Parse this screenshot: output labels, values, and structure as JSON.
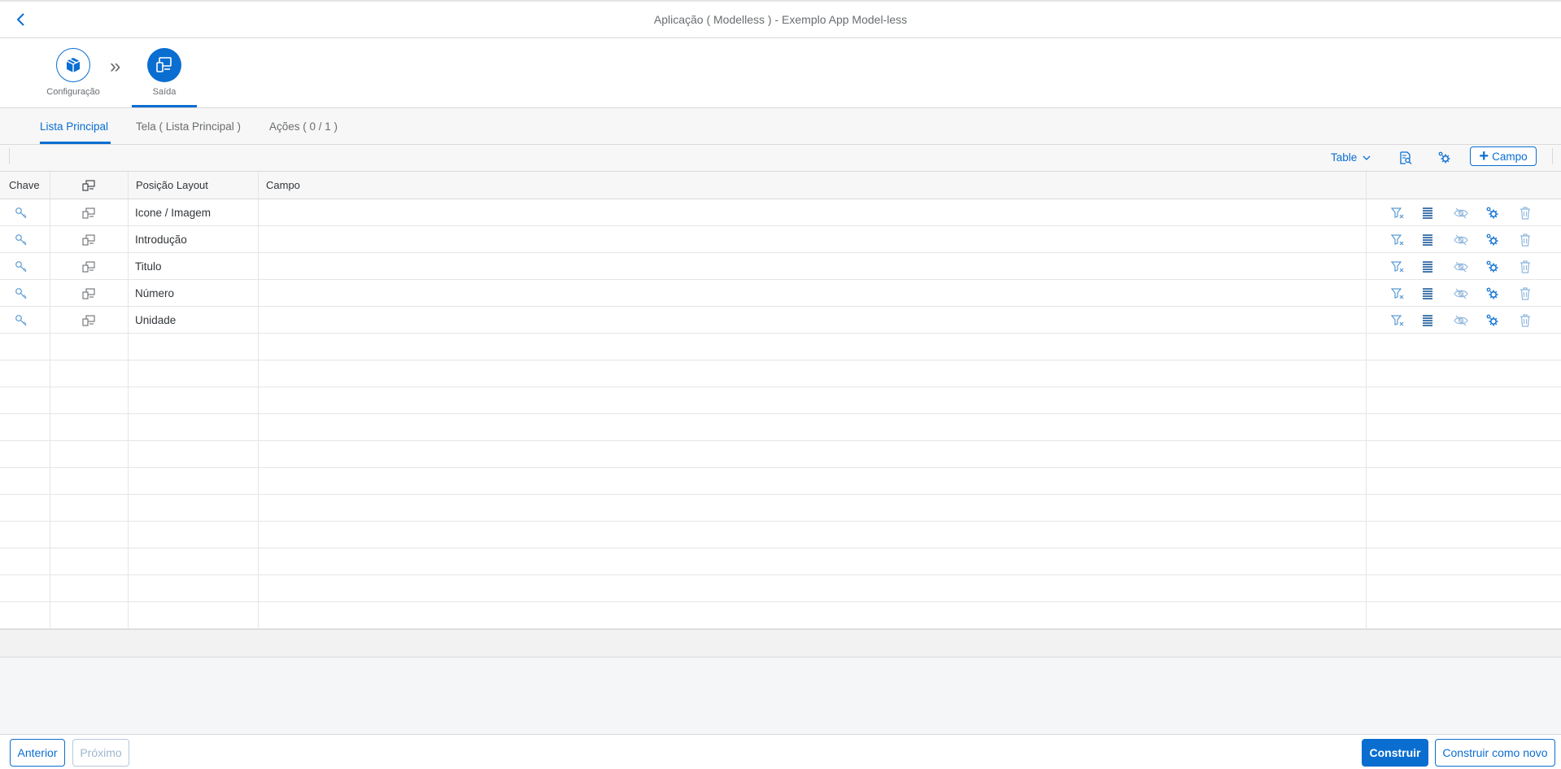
{
  "header": {
    "title": "Aplicação ( Modelless ) - Exemplo App Model-less"
  },
  "wizard": {
    "steps": [
      {
        "label": "Configuração",
        "icon": "package-icon"
      },
      {
        "label": "Saída",
        "icon": "devices-icon"
      }
    ]
  },
  "tabs": [
    {
      "label": "Lista Principal",
      "active": true
    },
    {
      "label": "Tela ( Lista Principal )",
      "active": false
    },
    {
      "label": "Ações ( 0 / 1 )",
      "active": false
    }
  ],
  "toolbar": {
    "view_select": "Table",
    "add_field_label": "Campo"
  },
  "table": {
    "columns": [
      "Chave",
      "",
      "Posição Layout",
      "Campo"
    ],
    "rows": [
      {
        "position": "Icone / Imagem",
        "campo": ""
      },
      {
        "position": "Introdução",
        "campo": ""
      },
      {
        "position": "Titulo",
        "campo": ""
      },
      {
        "position": "Número",
        "campo": ""
      },
      {
        "position": "Unidade",
        "campo": ""
      }
    ],
    "empty_rows": 11
  },
  "footer": {
    "prev_label": "Anterior",
    "next_label": "Próximo",
    "build_label": "Construir",
    "build_new_label": "Construir como novo"
  },
  "colors": {
    "accent": "#0a6ed1",
    "text": "#32363a",
    "muted": "#6a6d70"
  }
}
